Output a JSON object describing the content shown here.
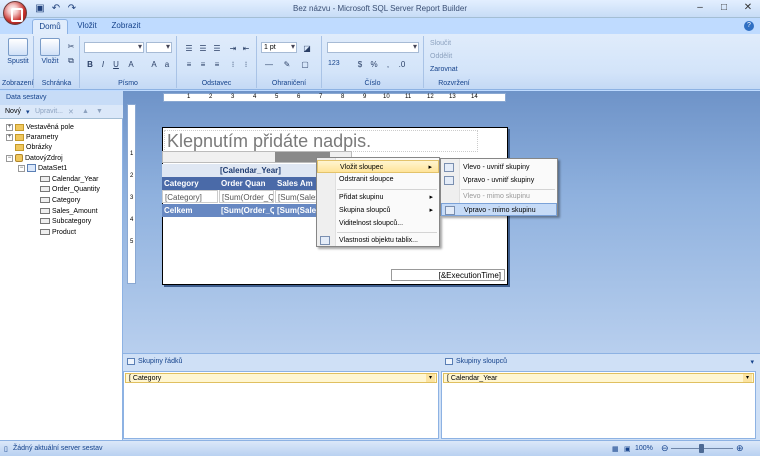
{
  "window": {
    "title": "Bez názvu - Microsoft SQL Server Report Builder",
    "minimize": "–",
    "maximize": "□",
    "close": "✕"
  },
  "tabs": [
    "Domů",
    "Vložit",
    "Zobrazit"
  ],
  "ribbon": {
    "groups": {
      "view": "Zobrazení",
      "clipboard": "Schránka",
      "font": "Písmo",
      "paragraph": "Odstavec",
      "border": "Ohraničení",
      "number": "Číslo",
      "layout": "Rozvržení"
    },
    "run_label": "Spustit",
    "paste_label": "Vložit",
    "border_size": "1 pt",
    "number_format": "123",
    "merge_label": "Sloučit",
    "split_label": "Oddělit",
    "align_label": "Zarovnat"
  },
  "left_panel": {
    "header": "Data sestavy",
    "new_label": "Nový",
    "edit_label": "Upravit..."
  },
  "tree": [
    {
      "label": "Vestavěná pole",
      "icon": "folder-icon"
    },
    {
      "label": "Parametry",
      "icon": "folder-icon"
    },
    {
      "label": "Obrázky",
      "icon": "folder-icon"
    },
    {
      "label": "DatovýZdroj",
      "icon": "database-icon"
    },
    {
      "label": "DataSet1",
      "icon": "dataset-icon"
    },
    {
      "label": "Calendar_Year",
      "icon": "field-icon"
    },
    {
      "label": "Order_Quantity",
      "icon": "field-icon"
    },
    {
      "label": "Category",
      "icon": "field-icon"
    },
    {
      "label": "Sales_Amount",
      "icon": "field-icon"
    },
    {
      "label": "Subcategory",
      "icon": "field-icon"
    },
    {
      "label": "Product",
      "icon": "field-icon"
    }
  ],
  "ruler_h": [
    "1",
    "2",
    "3",
    "4",
    "5",
    "6",
    "7",
    "8",
    "9",
    "10",
    "11",
    "12",
    "13",
    "14"
  ],
  "ruler_v": [
    "1",
    "2",
    "3",
    "4",
    "5"
  ],
  "report": {
    "title_placeholder": "Klepnutím přidáte nadpis.",
    "col_group": "[Calendar_Year]",
    "header_cells": [
      "Category",
      "Order Quan",
      "Sales Am"
    ],
    "detail_cells": [
      "[Category]",
      "[Sum(Order_Qu",
      "[Sum(Sales"
    ],
    "total_cells": [
      "Celkem",
      "[Sum(Order_Q",
      "[Sum(Sale"
    ],
    "exec_time": "[&ExecutionTime]"
  },
  "context_menu": {
    "items": [
      "Vložit sloupec",
      "Odstranit sloupce",
      "Přidat skupinu",
      "Skupina sloupců",
      "Viditelnost sloupců...",
      "Vlastnosti objektu tablix..."
    ]
  },
  "submenu": {
    "items": [
      "Vlevo - uvnitř skupiny",
      "Vpravo - uvnitř skupiny",
      "Vlevo - mimo skupinu",
      "Vpravo - mimo skupinu"
    ]
  },
  "groups": {
    "row_label": "Skupiny řádků",
    "row_item": "[ Category",
    "col_label": "Skupiny sloupců",
    "col_item": "[ Calendar_Year"
  },
  "status": {
    "text": "Žádný aktuální server sestav",
    "zoom": "100%"
  }
}
